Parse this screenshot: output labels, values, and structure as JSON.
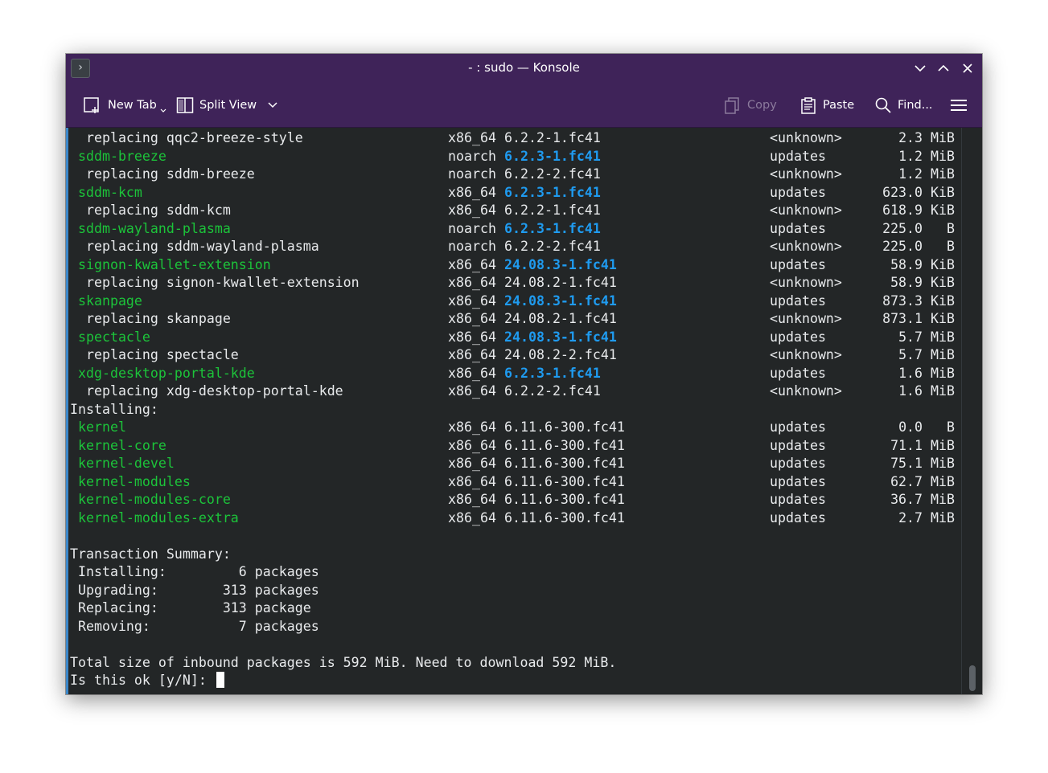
{
  "window": {
    "title": "- : sudo — Konsole"
  },
  "toolbar": {
    "new_tab": "New Tab",
    "split_view": "Split View",
    "copy": "Copy",
    "paste": "Paste",
    "find": "Find..."
  },
  "terminal": {
    "lines": [
      {
        "name": "  replacing qqc2-breeze-style",
        "name_color": "default",
        "arch": "x86_64",
        "version": "6.2.2-1.fc41",
        "version_color": "default",
        "repo": "<unknown>",
        "size": "2.3 MiB"
      },
      {
        "name": " sddm-breeze",
        "name_color": "green",
        "arch": "noarch",
        "version": "6.2.3-1.fc41",
        "version_color": "blue",
        "repo": "updates",
        "size": "1.2 MiB"
      },
      {
        "name": "  replacing sddm-breeze",
        "name_color": "default",
        "arch": "noarch",
        "version": "6.2.2-2.fc41",
        "version_color": "default",
        "repo": "<unknown>",
        "size": "1.2 MiB"
      },
      {
        "name": " sddm-kcm",
        "name_color": "green",
        "arch": "x86_64",
        "version": "6.2.3-1.fc41",
        "version_color": "blue",
        "repo": "updates",
        "size": "623.0 KiB"
      },
      {
        "name": "  replacing sddm-kcm",
        "name_color": "default",
        "arch": "x86_64",
        "version": "6.2.2-1.fc41",
        "version_color": "default",
        "repo": "<unknown>",
        "size": "618.9 KiB"
      },
      {
        "name": " sddm-wayland-plasma",
        "name_color": "green",
        "arch": "noarch",
        "version": "6.2.3-1.fc41",
        "version_color": "blue",
        "repo": "updates",
        "size": "225.0   B"
      },
      {
        "name": "  replacing sddm-wayland-plasma",
        "name_color": "default",
        "arch": "noarch",
        "version": "6.2.2-2.fc41",
        "version_color": "default",
        "repo": "<unknown>",
        "size": "225.0   B"
      },
      {
        "name": " signon-kwallet-extension",
        "name_color": "green",
        "arch": "x86_64",
        "version": "24.08.3-1.fc41",
        "version_color": "blue",
        "repo": "updates",
        "size": "58.9 KiB"
      },
      {
        "name": "  replacing signon-kwallet-extension",
        "name_color": "default",
        "arch": "x86_64",
        "version": "24.08.2-1.fc41",
        "version_color": "default",
        "repo": "<unknown>",
        "size": "58.9 KiB"
      },
      {
        "name": " skanpage",
        "name_color": "green",
        "arch": "x86_64",
        "version": "24.08.3-1.fc41",
        "version_color": "blue",
        "repo": "updates",
        "size": "873.3 KiB"
      },
      {
        "name": "  replacing skanpage",
        "name_color": "default",
        "arch": "x86_64",
        "version": "24.08.2-1.fc41",
        "version_color": "default",
        "repo": "<unknown>",
        "size": "873.1 KiB"
      },
      {
        "name": " spectacle",
        "name_color": "green",
        "arch": "x86_64",
        "version": "24.08.3-1.fc41",
        "version_color": "blue",
        "repo": "updates",
        "size": "5.7 MiB"
      },
      {
        "name": "  replacing spectacle",
        "name_color": "default",
        "arch": "x86_64",
        "version": "24.08.2-2.fc41",
        "version_color": "default",
        "repo": "<unknown>",
        "size": "5.7 MiB"
      },
      {
        "name": " xdg-desktop-portal-kde",
        "name_color": "green",
        "arch": "x86_64",
        "version": "6.2.3-1.fc41",
        "version_color": "blue",
        "repo": "updates",
        "size": "1.6 MiB"
      },
      {
        "name": "  replacing xdg-desktop-portal-kde",
        "name_color": "default",
        "arch": "x86_64",
        "version": "6.2.2-2.fc41",
        "version_color": "default",
        "repo": "<unknown>",
        "size": "1.6 MiB"
      },
      {
        "name": "Installing:",
        "name_color": "default",
        "arch": "",
        "version": "",
        "version_color": "default",
        "repo": "",
        "size": ""
      },
      {
        "name": " kernel",
        "name_color": "green",
        "arch": "x86_64",
        "version": "6.11.6-300.fc41",
        "version_color": "default",
        "repo": "updates",
        "size": "0.0   B"
      },
      {
        "name": " kernel-core",
        "name_color": "green",
        "arch": "x86_64",
        "version": "6.11.6-300.fc41",
        "version_color": "default",
        "repo": "updates",
        "size": "71.1 MiB"
      },
      {
        "name": " kernel-devel",
        "name_color": "green",
        "arch": "x86_64",
        "version": "6.11.6-300.fc41",
        "version_color": "default",
        "repo": "updates",
        "size": "75.1 MiB"
      },
      {
        "name": " kernel-modules",
        "name_color": "green",
        "arch": "x86_64",
        "version": "6.11.6-300.fc41",
        "version_color": "default",
        "repo": "updates",
        "size": "62.7 MiB"
      },
      {
        "name": " kernel-modules-core",
        "name_color": "green",
        "arch": "x86_64",
        "version": "6.11.6-300.fc41",
        "version_color": "default",
        "repo": "updates",
        "size": "36.7 MiB"
      },
      {
        "name": " kernel-modules-extra",
        "name_color": "green",
        "arch": "x86_64",
        "version": "6.11.6-300.fc41",
        "version_color": "default",
        "repo": "updates",
        "size": "2.7 MiB"
      },
      {
        "name": "",
        "name_color": "default",
        "arch": "",
        "version": "",
        "version_color": "default",
        "repo": "",
        "size": ""
      },
      {
        "name": "Transaction Summary:",
        "name_color": "default",
        "arch": "",
        "version": "",
        "version_color": "default",
        "repo": "",
        "size": ""
      },
      {
        "name": " Installing:         6 packages",
        "name_color": "default",
        "arch": "",
        "version": "",
        "version_color": "default",
        "repo": "",
        "size": ""
      },
      {
        "name": " Upgrading:        313 packages",
        "name_color": "default",
        "arch": "",
        "version": "",
        "version_color": "default",
        "repo": "",
        "size": ""
      },
      {
        "name": " Replacing:        313 package",
        "name_color": "default",
        "arch": "",
        "version": "",
        "version_color": "default",
        "repo": "",
        "size": ""
      },
      {
        "name": " Removing:           7 packages",
        "name_color": "default",
        "arch": "",
        "version": "",
        "version_color": "default",
        "repo": "",
        "size": ""
      },
      {
        "name": "",
        "name_color": "default",
        "arch": "",
        "version": "",
        "version_color": "default",
        "repo": "",
        "size": ""
      },
      {
        "name": "Total size of inbound packages is 592 MiB. Need to download 592 MiB.",
        "name_color": "default",
        "arch": "",
        "version": "",
        "version_color": "default",
        "repo": "",
        "size": ""
      }
    ],
    "prompt": "Is this ok [y/N]: "
  },
  "colors": {
    "titlebar": "#3f2359",
    "terminal_bg": "#232627",
    "terminal_fg": "#e8eaec",
    "package_green": "#1cc43a",
    "version_blue": "#1f9bf0",
    "accent": "#3a86c8"
  },
  "icons": {
    "app": "konsole-icon",
    "minimize": "chevron-down-icon",
    "maximize": "chevron-up-icon",
    "close": "close-icon",
    "new_tab": "new-tab-icon",
    "split_view": "split-view-icon",
    "copy": "copy-icon",
    "paste": "paste-icon",
    "find": "search-icon",
    "menu": "hamburger-menu-icon"
  }
}
